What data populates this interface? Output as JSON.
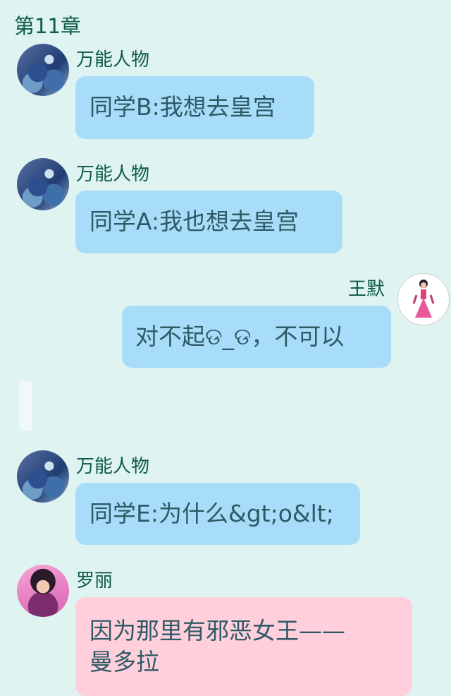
{
  "header": {
    "title": "第11章"
  },
  "messages": [
    {
      "sender": "万能人物",
      "text": "同学B:我想去皇宫",
      "side": "left",
      "color": "blue"
    },
    {
      "sender": "万能人物",
      "text": "同学A:我也想去皇宫",
      "side": "left",
      "color": "blue"
    },
    {
      "sender": "王默",
      "text": "对不起ଡ_ଡ，不可以",
      "side": "right",
      "color": "blue"
    },
    {
      "sender": "万能人物",
      "text": "同学E:为什么&gt;o&lt;",
      "side": "left",
      "color": "blue"
    },
    {
      "sender": "罗丽",
      "text": "因为那里有邪恶女王——曼多拉",
      "line1": "因为那里有邪恶女王——",
      "line2": "曼多拉",
      "side": "left",
      "color": "pink"
    }
  ],
  "colors": {
    "background": "#dff3f1",
    "bubble_blue": "#a8ddfa",
    "bubble_pink": "#ffd0dc",
    "name": "#0f5a4a"
  }
}
